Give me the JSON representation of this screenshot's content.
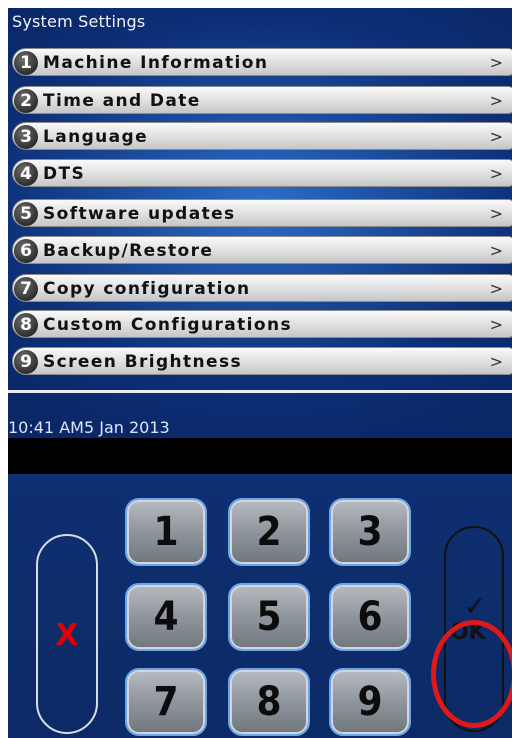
{
  "title": "System Settings",
  "menu": [
    {
      "num": "1",
      "label": "Machine Information",
      "chevron": ">"
    },
    {
      "num": "2",
      "label": "Time and Date",
      "chevron": ">"
    },
    {
      "num": "3",
      "label": "Language",
      "chevron": ">"
    },
    {
      "num": "4",
      "label": "DTS",
      "chevron": ">"
    },
    {
      "num": "5",
      "label": "Software updates",
      "chevron": ">"
    },
    {
      "num": "6",
      "label": "Backup/Restore",
      "chevron": ">"
    },
    {
      "num": "7",
      "label": "Copy configuration",
      "chevron": ">"
    },
    {
      "num": "8",
      "label": "Custom Configurations",
      "chevron": ">"
    },
    {
      "num": "9",
      "label": "Screen Brightness",
      "chevron": ">"
    }
  ],
  "status": {
    "time": "10:41 AM",
    "date": "5 Jan 2013"
  },
  "keypad": {
    "keys": [
      "1",
      "2",
      "3",
      "4",
      "5",
      "6",
      "7",
      "8",
      "9"
    ]
  },
  "cancel_label": "X",
  "ok": {
    "check": "✓",
    "label": "OK"
  },
  "colors": {
    "background": "#0d2f77",
    "highlight": "#e11818",
    "cancel": "#e10000"
  }
}
